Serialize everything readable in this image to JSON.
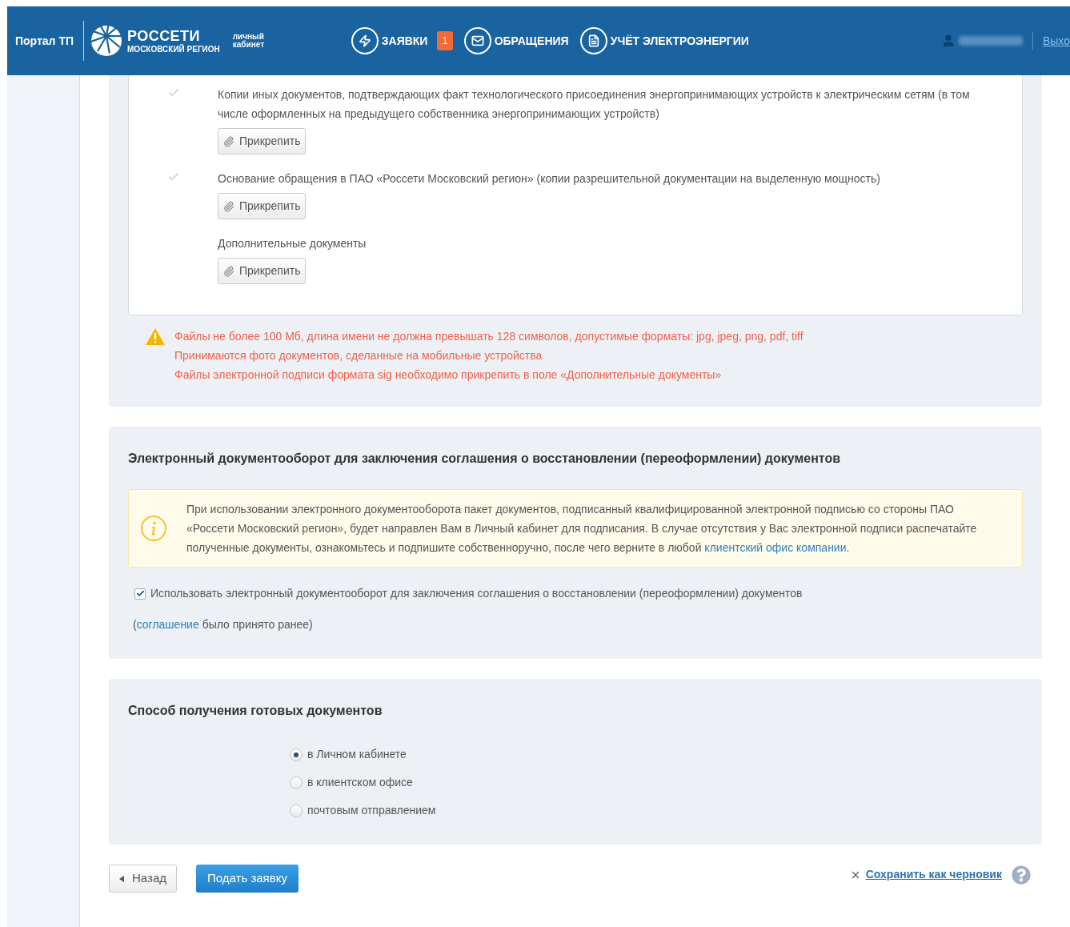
{
  "header": {
    "portal": "Портал ТП",
    "brand_name": "РОССЕТИ",
    "brand_region": "МОСКОВСКИЙ РЕГИОН",
    "cabinet": "личный кабинет",
    "nav": [
      {
        "label": "ЗАЯВКИ",
        "kind": "bolt",
        "badge": "1"
      },
      {
        "label": "ОБРАЩЕНИЯ",
        "kind": "mail"
      },
      {
        "label": "УЧЁТ ЭЛЕКТРОЭНЕРГИИ",
        "kind": "document"
      }
    ],
    "logout": "Выхо"
  },
  "documents": [
    {
      "text": "Копии иных документов, подтверждающих факт технологического присоединения энергопринимающих устройств к электрическим сетям (в том числе оформленных на предыдущего собственника энергопринимающих устройств)",
      "check_mark": true,
      "button": "Прикрепить"
    },
    {
      "text": "Основание обращения в ПАО «Россети Московский регион» (копии разрешительной документации на выделенную мощность)",
      "check_mark": true,
      "button": "Прикрепить"
    },
    {
      "text": "Дополнительные документы",
      "check_mark": false,
      "button": "Прикрепить"
    }
  ],
  "file_notes": [
    "Файлы не более 100 Мб, длина имени не должна превышать 128 символов, допустимые форматы: jpg, jpeg, png, pdf, tiff",
    "Принимаются фото документов, сделанные на мобильные устройства",
    "Файлы электронной подписи формата sig необходимо прикрепить в поле «Дополнительные документы»"
  ],
  "edo": {
    "title": "Электронный документооборот для заключения соглашения о восстановлении (переоформлении) документов",
    "info": {
      "text": "При использовании электронного документооборота пакет документов, подписанный квалифицированной электронной подписью со стороны ПАО «Россети Московский регион», будет направлен Вам в Личный кабинет для подписания. В случае отсутствия у Вас электронной подписи распечатайте полученные документы, ознакомьтесь и подпишите собственноручно, после чего верните в любой",
      "link": "клиентский офис компании",
      "after": "."
    },
    "agreement": {
      "label": "Использовать электронный документооборот для заключения соглашения о восстановлении (переоформлении) документов",
      "checked": true
    },
    "note": {
      "open": "(",
      "link": "соглашение",
      "rest": "было принято ранее)"
    }
  },
  "delivery": {
    "title": "Способ получения готовых документов",
    "options": [
      {
        "label": "в Личном кабинете",
        "selected": true
      },
      {
        "label": "в клиентском офисе",
        "selected": false
      },
      {
        "label": "почтовым отправлением",
        "selected": false
      }
    ]
  },
  "actions": {
    "back": "Назад",
    "submit": "Подать заявку",
    "save": "Сохранить как черновик"
  }
}
